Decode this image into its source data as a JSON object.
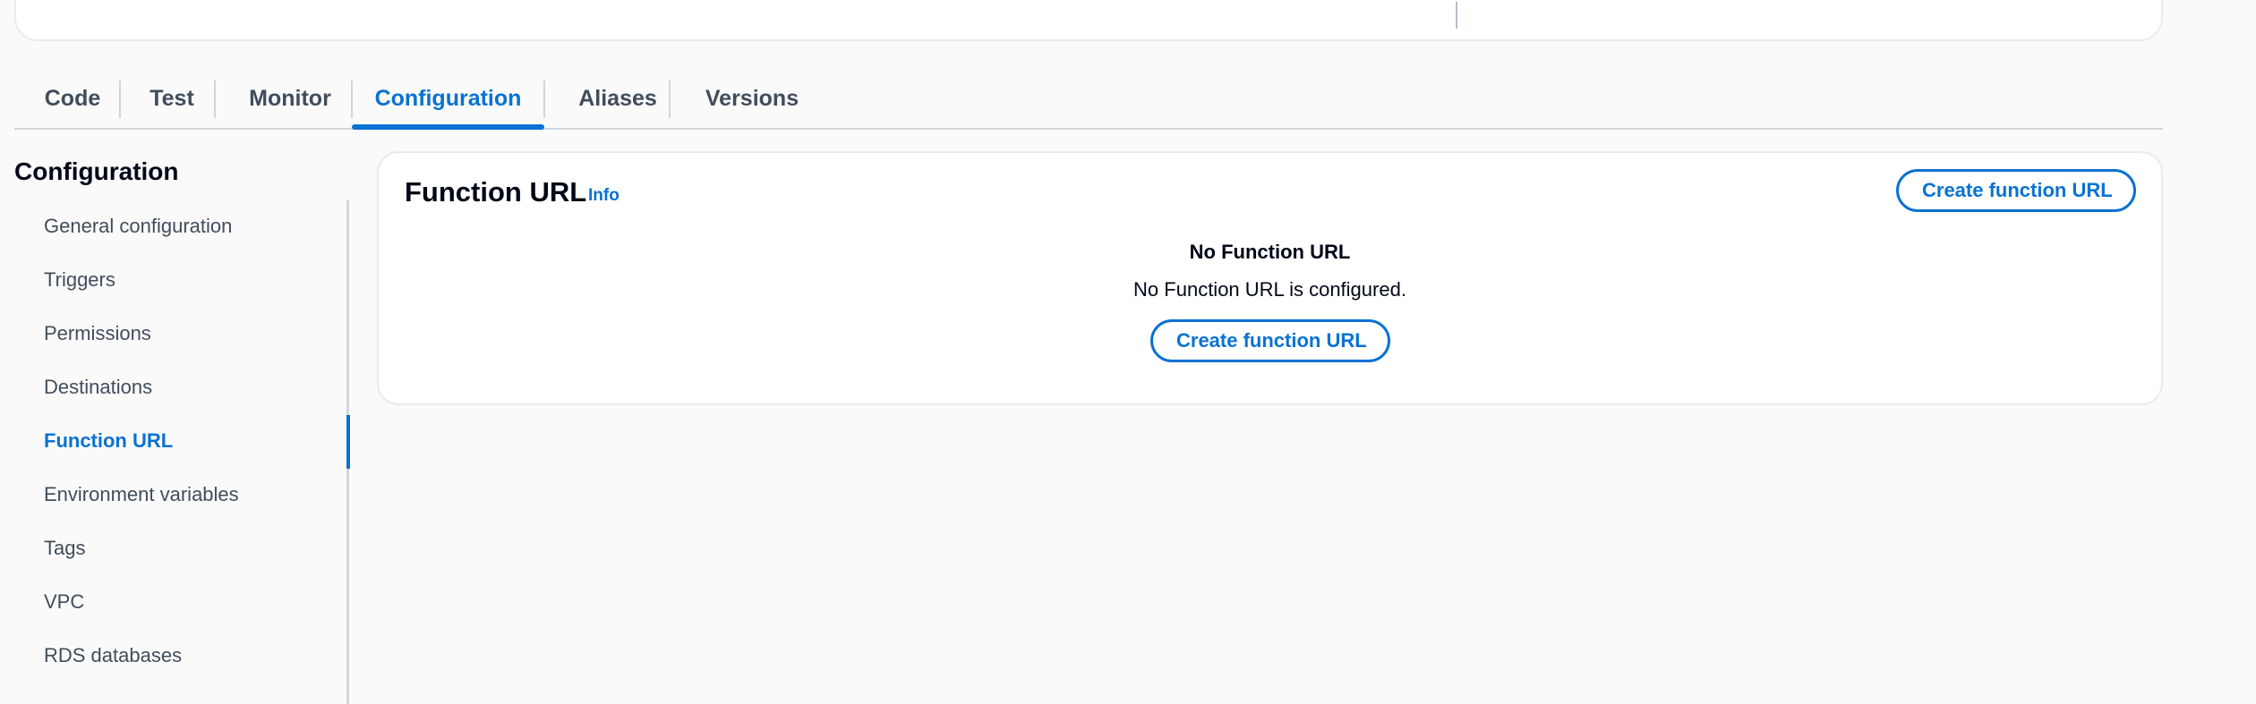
{
  "tabs": [
    {
      "label": "Code"
    },
    {
      "label": "Test"
    },
    {
      "label": "Monitor"
    },
    {
      "label": "Configuration",
      "active": true
    },
    {
      "label": "Aliases"
    },
    {
      "label": "Versions"
    }
  ],
  "sidebar": {
    "title": "Configuration",
    "items": [
      {
        "label": "General configuration"
      },
      {
        "label": "Triggers"
      },
      {
        "label": "Permissions"
      },
      {
        "label": "Destinations"
      },
      {
        "label": "Function URL",
        "active": true
      },
      {
        "label": "Environment variables"
      },
      {
        "label": "Tags"
      },
      {
        "label": "VPC"
      },
      {
        "label": "RDS databases"
      }
    ]
  },
  "panel": {
    "title": "Function URL",
    "info_label": "Info",
    "header_button": "Create function URL",
    "empty_title": "No Function URL",
    "empty_description": "No Function URL is configured.",
    "empty_button": "Create function URL"
  },
  "colors": {
    "accent": "#0972d3",
    "text": "#16191f",
    "muted": "#414d5c",
    "background": "#fafafa"
  }
}
